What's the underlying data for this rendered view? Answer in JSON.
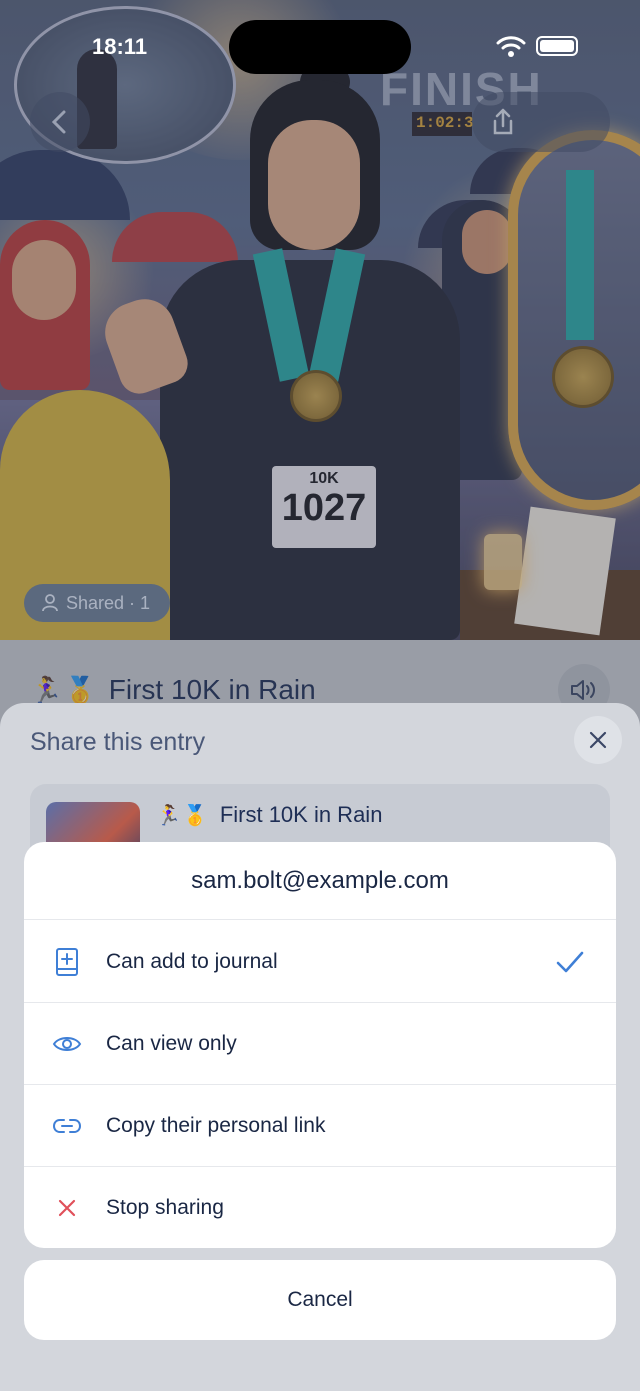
{
  "status_bar": {
    "time": "18:11"
  },
  "hero": {
    "finish_sign": "FINISH",
    "clock_text": "1:02:3",
    "bib_distance": "10K",
    "bib_number": "1027",
    "shared_chip": "Shared · 1"
  },
  "entry": {
    "emoji": "🏃‍♀️🥇",
    "title": "First 10K in Rain"
  },
  "share_sheet": {
    "title": "Share this entry",
    "entry_card": {
      "emoji": "🏃‍♀️🥇",
      "title": "First 10K in Rain"
    }
  },
  "action_sheet": {
    "email": "sam.bolt@example.com",
    "items": [
      {
        "label": "Can add to journal",
        "icon": "journal-add-icon",
        "selected": true
      },
      {
        "label": "Can view only",
        "icon": "eye-icon",
        "selected": false
      },
      {
        "label": "Copy their personal link",
        "icon": "link-icon",
        "selected": false
      },
      {
        "label": "Stop sharing",
        "icon": "x-icon",
        "selected": false
      }
    ],
    "cancel": "Cancel"
  },
  "colors": {
    "accent": "#3f7fd6",
    "destructive": "#e0505a",
    "text": "#1a2744"
  }
}
